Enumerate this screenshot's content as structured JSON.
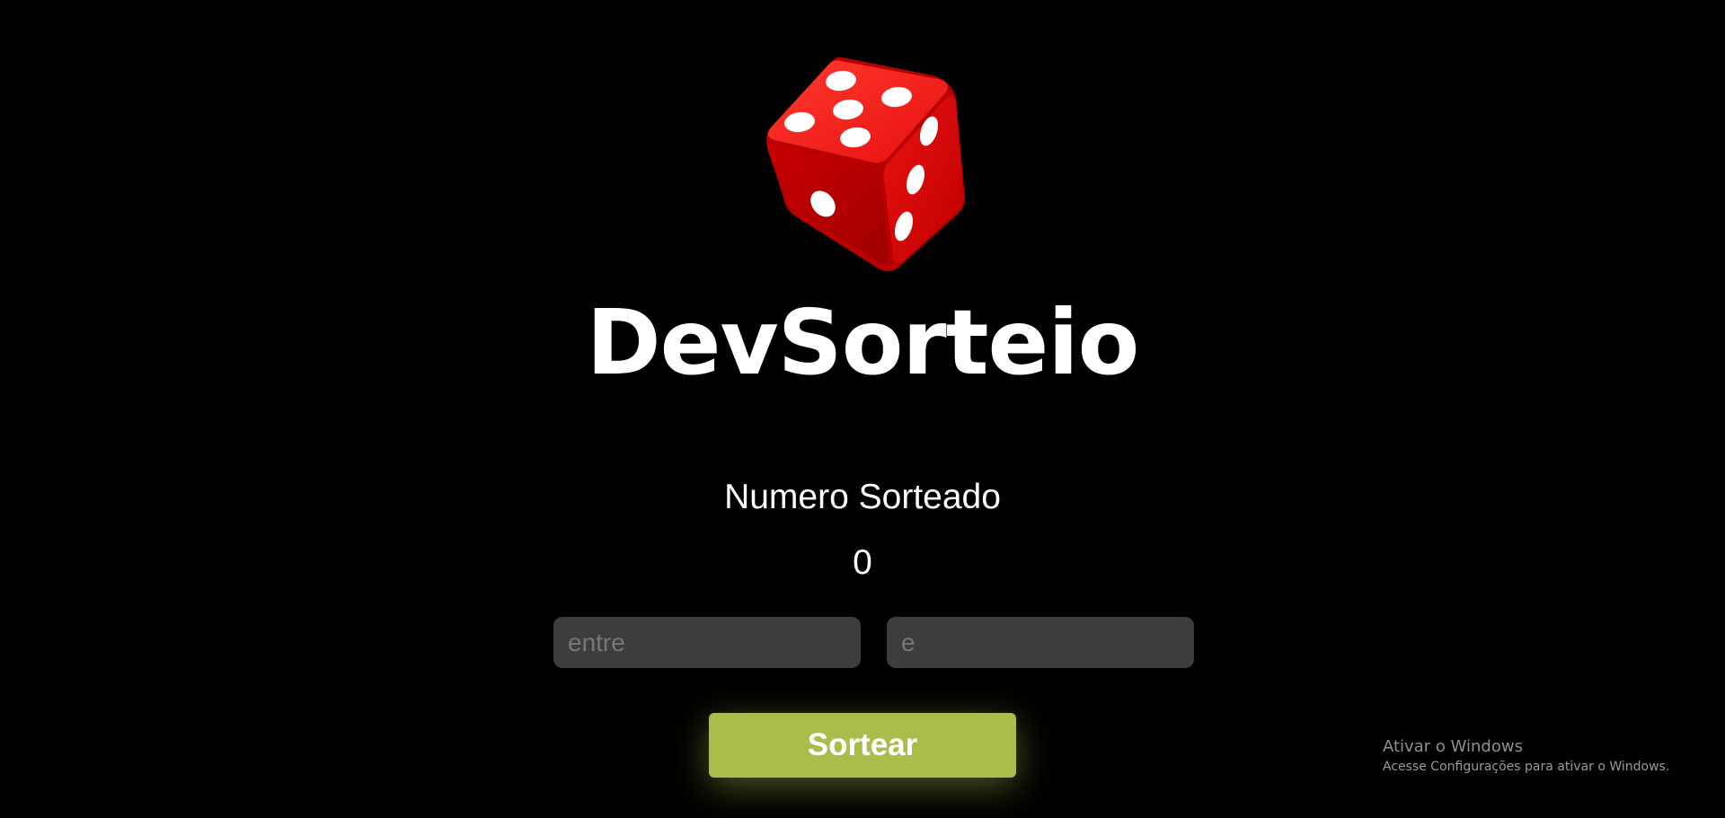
{
  "app": {
    "title": "DevSorteio",
    "logo_icon": "dice-icon",
    "accent_color": "#a9bd4b",
    "dice_color": "#e00000"
  },
  "result": {
    "label": "Numero Sorteado",
    "value": "0"
  },
  "inputs": {
    "min": {
      "placeholder": "entre",
      "value": ""
    },
    "max": {
      "placeholder": "e",
      "value": ""
    }
  },
  "actions": {
    "draw_label": "Sortear"
  },
  "watermark": {
    "title": "Ativar o Windows",
    "subtitle": "Acesse Configurações para ativar o Windows."
  }
}
